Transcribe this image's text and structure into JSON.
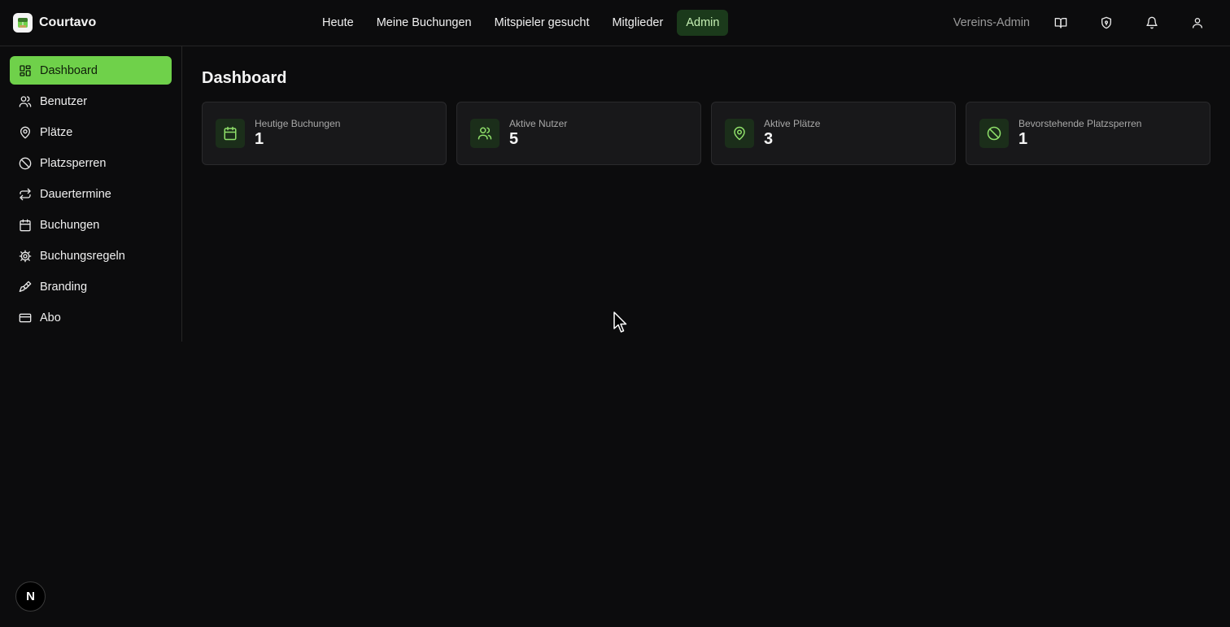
{
  "app": {
    "name": "Courtavo"
  },
  "topnav": {
    "items": [
      {
        "label": "Heute"
      },
      {
        "label": "Meine Buchungen"
      },
      {
        "label": "Mitspieler gesucht"
      },
      {
        "label": "Mitglieder"
      },
      {
        "label": "Admin",
        "active": true
      }
    ],
    "role": "Vereins-Admin",
    "icons": [
      "book-icon",
      "shield-icon",
      "bell-icon",
      "user-icon"
    ]
  },
  "sidebar": {
    "items": [
      {
        "label": "Dashboard",
        "icon": "dashboard-icon",
        "active": true
      },
      {
        "label": "Benutzer",
        "icon": "users-icon"
      },
      {
        "label": "Plätze",
        "icon": "map-pin-icon"
      },
      {
        "label": "Platzsperren",
        "icon": "ban-icon"
      },
      {
        "label": "Dauertermine",
        "icon": "repeat-icon"
      },
      {
        "label": "Buchungen",
        "icon": "calendar-icon"
      },
      {
        "label": "Buchungsregeln",
        "icon": "gear-icon"
      },
      {
        "label": "Branding",
        "icon": "paintbrush-icon"
      },
      {
        "label": "Abo",
        "icon": "credit-card-icon"
      }
    ]
  },
  "main": {
    "title": "Dashboard",
    "cards": [
      {
        "label": "Heutige Buchungen",
        "value": "1",
        "icon": "calendar-icon"
      },
      {
        "label": "Aktive Nutzer",
        "value": "5",
        "icon": "users-icon"
      },
      {
        "label": "Aktive Plätze",
        "value": "3",
        "icon": "map-pin-icon"
      },
      {
        "label": "Bevorstehende Platzsperren",
        "value": "1",
        "icon": "ban-icon"
      }
    ]
  },
  "badge": {
    "label": "N"
  },
  "colors": {
    "accent": "#6fd14a",
    "background": "#0c0c0d",
    "card": "#18181a"
  }
}
